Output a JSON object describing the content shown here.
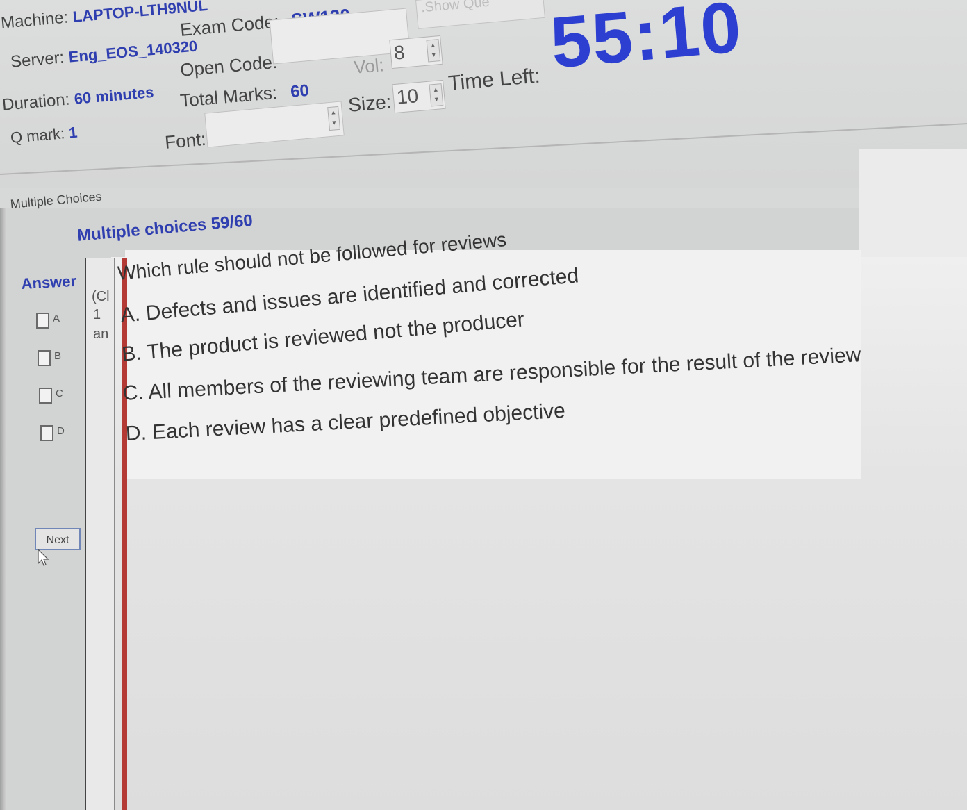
{
  "header": {
    "machine_label": "Machine:",
    "machine_value": "LAPTOP-LTH9NUL",
    "server_label": "Server:",
    "server_value": "Eng_EOS_140320",
    "exam_code_label": "Exam Code:",
    "exam_code_value": "SW130",
    "duration_label": "Duration:",
    "duration_value": "60 minutes",
    "open_code_label": "Open Code:",
    "total_marks_label": "Total Marks:",
    "total_marks_value": "60",
    "qmark_label": "Q mark:",
    "qmark_value": "1",
    "font_label": "Font:",
    "vol_label": "Vol:",
    "vol_value": "8",
    "size_label": "Size:",
    "size_value": "10",
    "time_left_label": "Time Left:",
    "time_left_value": "55:10",
    "show_button_label": ".Show Que"
  },
  "tab": {
    "label": "Multiple Choices"
  },
  "question": {
    "heading": "Multiple choices 59/60",
    "text": "Which rule should not be followed for reviews",
    "id_col": [
      "(Cl",
      "1",
      "an"
    ],
    "options": [
      {
        "letter": "A",
        "text": "A. Defects and issues are identified and corrected"
      },
      {
        "letter": "B",
        "text": "B. The product is reviewed not the producer"
      },
      {
        "letter": "C",
        "text": "C. All members of the reviewing team are responsible for the result of the review"
      },
      {
        "letter": "D",
        "text": "D. Each review has a clear predefined objective"
      }
    ]
  },
  "answer": {
    "label": "Answer",
    "choices": [
      "A",
      "B",
      "C",
      "D"
    ],
    "next_label": "Next"
  }
}
